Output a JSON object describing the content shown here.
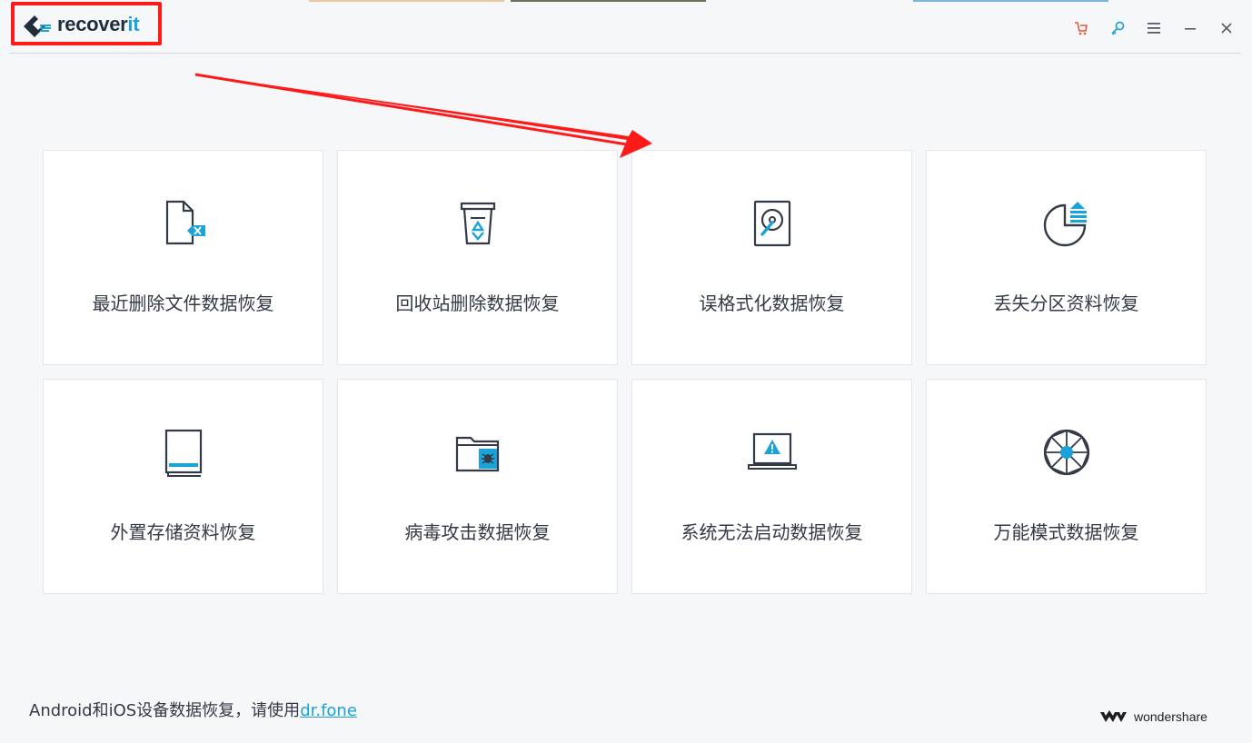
{
  "app": {
    "logo_text_main": "recover",
    "logo_text_accent": "it"
  },
  "window_controls": [
    {
      "name": "cart-icon"
    },
    {
      "name": "key-icon"
    },
    {
      "name": "menu-icon"
    },
    {
      "name": "minimize-icon"
    },
    {
      "name": "close-icon"
    }
  ],
  "cards": [
    {
      "label": "最近删除文件数据恢复",
      "icon": "deleted-file-icon"
    },
    {
      "label": "回收站删除数据恢复",
      "icon": "recycle-bin-icon"
    },
    {
      "label": "误格式化数据恢复",
      "icon": "formatted-disk-icon"
    },
    {
      "label": "丢失分区资料恢复",
      "icon": "lost-partition-icon"
    },
    {
      "label": "外置存储资料恢复",
      "icon": "external-storage-icon"
    },
    {
      "label": "病毒攻击数据恢复",
      "icon": "virus-folder-icon"
    },
    {
      "label": "系统无法启动数据恢复",
      "icon": "system-crash-icon"
    },
    {
      "label": "万能模式数据恢复",
      "icon": "all-around-icon"
    }
  ],
  "footer": {
    "text": "Android和iOS设备数据恢复，请使用",
    "link": "dr.fone",
    "brand": "wondershare"
  },
  "colors": {
    "accent": "#1aa3d9",
    "dark": "#333a45",
    "annotation": "#ff1a1a",
    "cart": "#e8553a"
  }
}
